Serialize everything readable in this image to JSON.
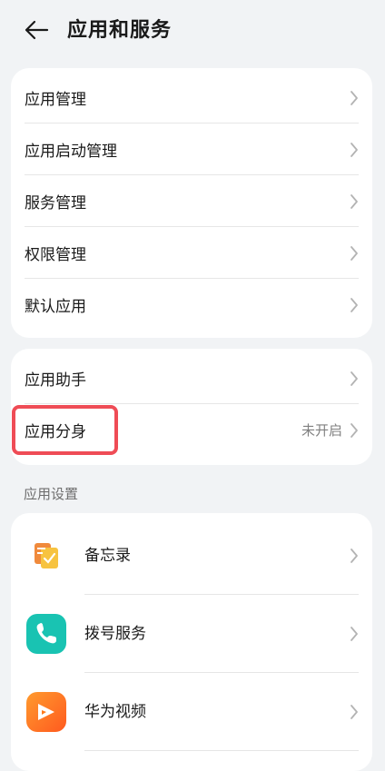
{
  "header": {
    "title": "应用和服务",
    "back_icon": "arrow-left-icon"
  },
  "group1": {
    "items": [
      {
        "label": "应用管理"
      },
      {
        "label": "应用启动管理"
      },
      {
        "label": "服务管理"
      },
      {
        "label": "权限管理"
      },
      {
        "label": "默认应用"
      }
    ]
  },
  "group2": {
    "items": [
      {
        "label": "应用助手",
        "value": ""
      },
      {
        "label": "应用分身",
        "value": "未开启"
      }
    ]
  },
  "app_settings": {
    "title": "应用设置",
    "items": [
      {
        "label": "备忘录",
        "icon": "notepad-icon",
        "color": "#f2a93b"
      },
      {
        "label": "拨号服务",
        "icon": "phone-icon",
        "color": "#19c3b2"
      },
      {
        "label": "华为视频",
        "icon": "video-play-icon",
        "color": "#ff7a1a"
      }
    ]
  },
  "colors": {
    "highlight": "#ef4c56",
    "background": "#f1f3f5"
  }
}
